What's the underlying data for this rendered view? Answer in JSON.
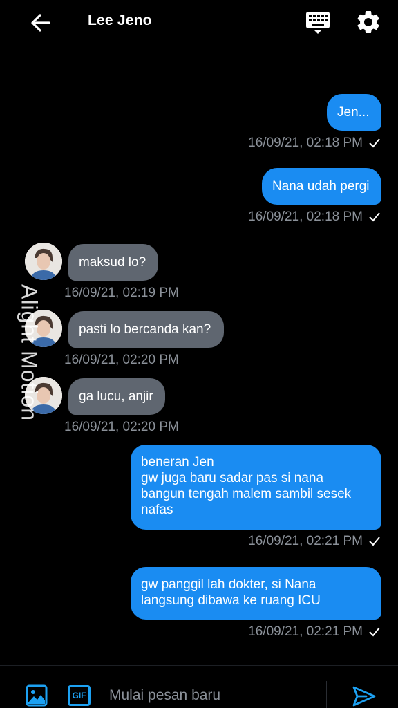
{
  "header": {
    "title": "Lee Jeno",
    "icons": {
      "back": "arrow-left-icon",
      "keyboard": "keyboard-icon",
      "settings": "gear-icon"
    }
  },
  "messages": [
    {
      "direction": "out",
      "text": "Jen...",
      "time": "16/09/21, 02:18 PM"
    },
    {
      "direction": "out",
      "text": "Nana udah pergi",
      "time": "16/09/21, 02:18 PM"
    },
    {
      "direction": "in",
      "text": "maksud lo?",
      "time": "16/09/21, 02:19 PM"
    },
    {
      "direction": "in",
      "text": "pasti lo bercanda kan?",
      "time": "16/09/21, 02:20 PM"
    },
    {
      "direction": "in",
      "text": "ga lucu, anjir",
      "time": "16/09/21, 02:20 PM"
    },
    {
      "direction": "out",
      "text": "beneran Jen\ngw juga baru sadar pas si nana\nbangun tengah malem sambil sesek\nnafas",
      "time": "16/09/21, 02:21 PM"
    },
    {
      "direction": "out",
      "text": "gw panggil lah dokter, si Nana\nlangsung dibawa ke ruang ICU",
      "time": "16/09/21, 02:21 PM"
    }
  ],
  "watermark": "Alight Motion",
  "composer": {
    "placeholder": "Mulai pesan baru",
    "gif_label": "GIF"
  },
  "colors": {
    "background": "#000000",
    "outgoing_bubble": "#1a8cf2",
    "incoming_bubble": "#5f6670",
    "timestamp": "#8b9199",
    "accent": "#1da1f2"
  }
}
